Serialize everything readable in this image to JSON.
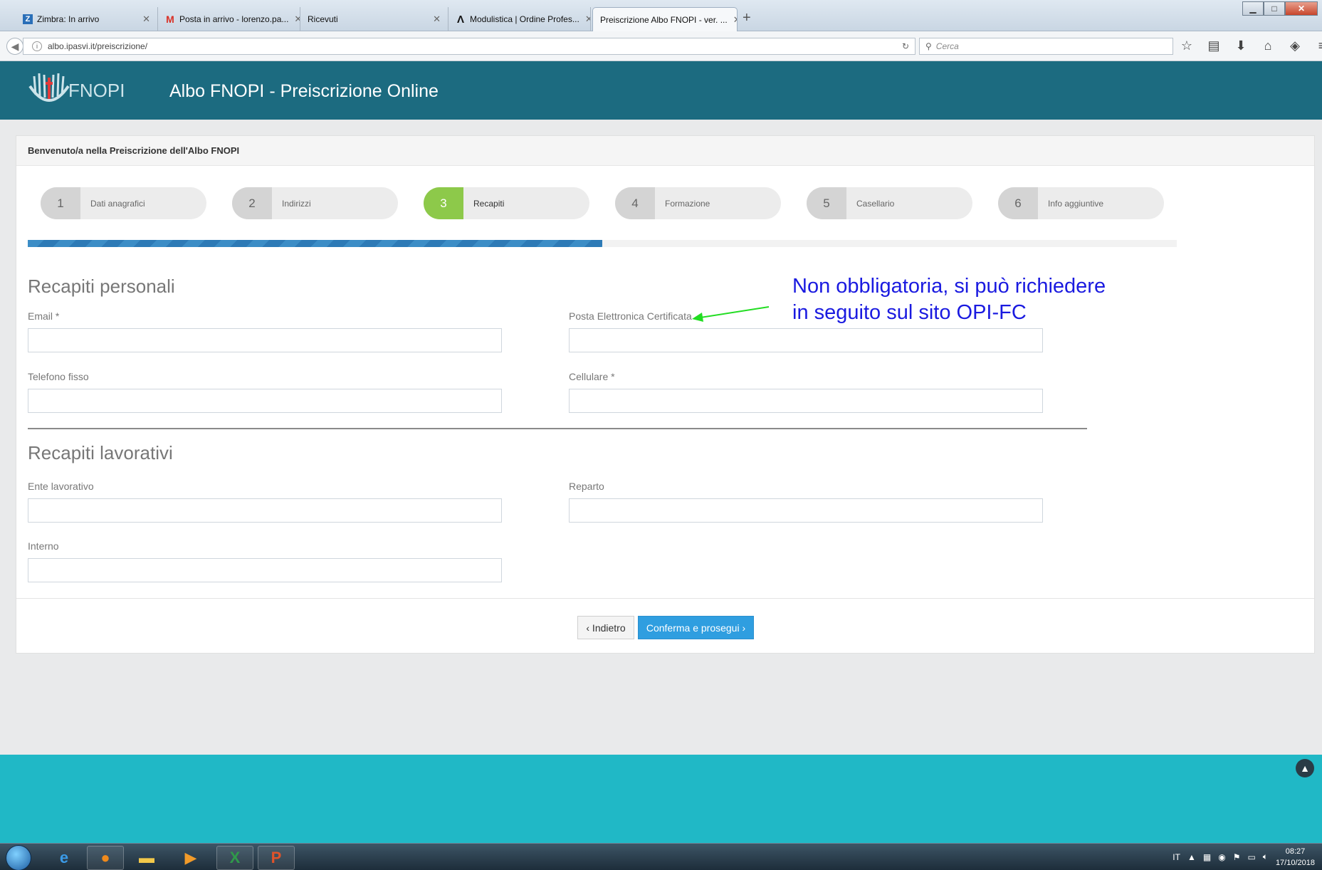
{
  "browser": {
    "tabs": [
      {
        "title": "Zimbra: In arrivo",
        "icon": "zimbra-icon"
      },
      {
        "title": "Posta in arrivo - lorenzo.pa...",
        "icon": "gmail-icon"
      },
      {
        "title": "Ricevuti",
        "icon": ""
      },
      {
        "title": "Modulistica | Ordine Profes...",
        "icon": "lambda-icon"
      },
      {
        "title": "Preiscrizione Albo FNOPI - ver. ...",
        "icon": ""
      }
    ],
    "url": "albo.ipasvi.it/preiscrizione/",
    "search_placeholder": "Cerca"
  },
  "site": {
    "logo_text": "FNOPI",
    "title": "Albo FNOPI - Preiscrizione Online"
  },
  "card": {
    "heading": "Benvenuto/a nella Preiscrizione dell'Albo FNOPI"
  },
  "steps": [
    {
      "num": "1",
      "label": "Dati anagrafici",
      "active": false
    },
    {
      "num": "2",
      "label": "Indirizzi",
      "active": false
    },
    {
      "num": "3",
      "label": "Recapiti",
      "active": true
    },
    {
      "num": "4",
      "label": "Formazione",
      "active": false
    },
    {
      "num": "5",
      "label": "Casellario",
      "active": false
    },
    {
      "num": "6",
      "label": "Info aggiuntive",
      "active": false
    }
  ],
  "progress_fraction": 0.5,
  "personal": {
    "title": "Recapiti personali",
    "email_label": "Email *",
    "email_value": "",
    "pec_label": "Posta Elettronica Certificata",
    "pec_value": "",
    "phone_label": "Telefono fisso",
    "phone_value": "",
    "mobile_label": "Cellulare *",
    "mobile_value": ""
  },
  "work": {
    "title": "Recapiti lavorativi",
    "employer_label": "Ente lavorativo",
    "employer_value": "",
    "department_label": "Reparto",
    "department_value": "",
    "extension_label": "Interno",
    "extension_value": ""
  },
  "buttons": {
    "back": "‹ Indietro",
    "next": "Conferma e prosegui ›"
  },
  "annotation": {
    "line1": "Non obbligatoria, si può richiedere",
    "line2": "in seguito sul sito OPI-FC",
    "color": "#1a1ae0",
    "arrow_color": "#22dd22"
  },
  "taskbar": {
    "language": "IT",
    "time": "08:27",
    "date": "17/10/2018"
  },
  "colors": {
    "header_bg": "#1c6b80",
    "footer_bg": "#20b8c6",
    "active_step": "#8dc94a",
    "primary_button": "#2f9ee0"
  }
}
